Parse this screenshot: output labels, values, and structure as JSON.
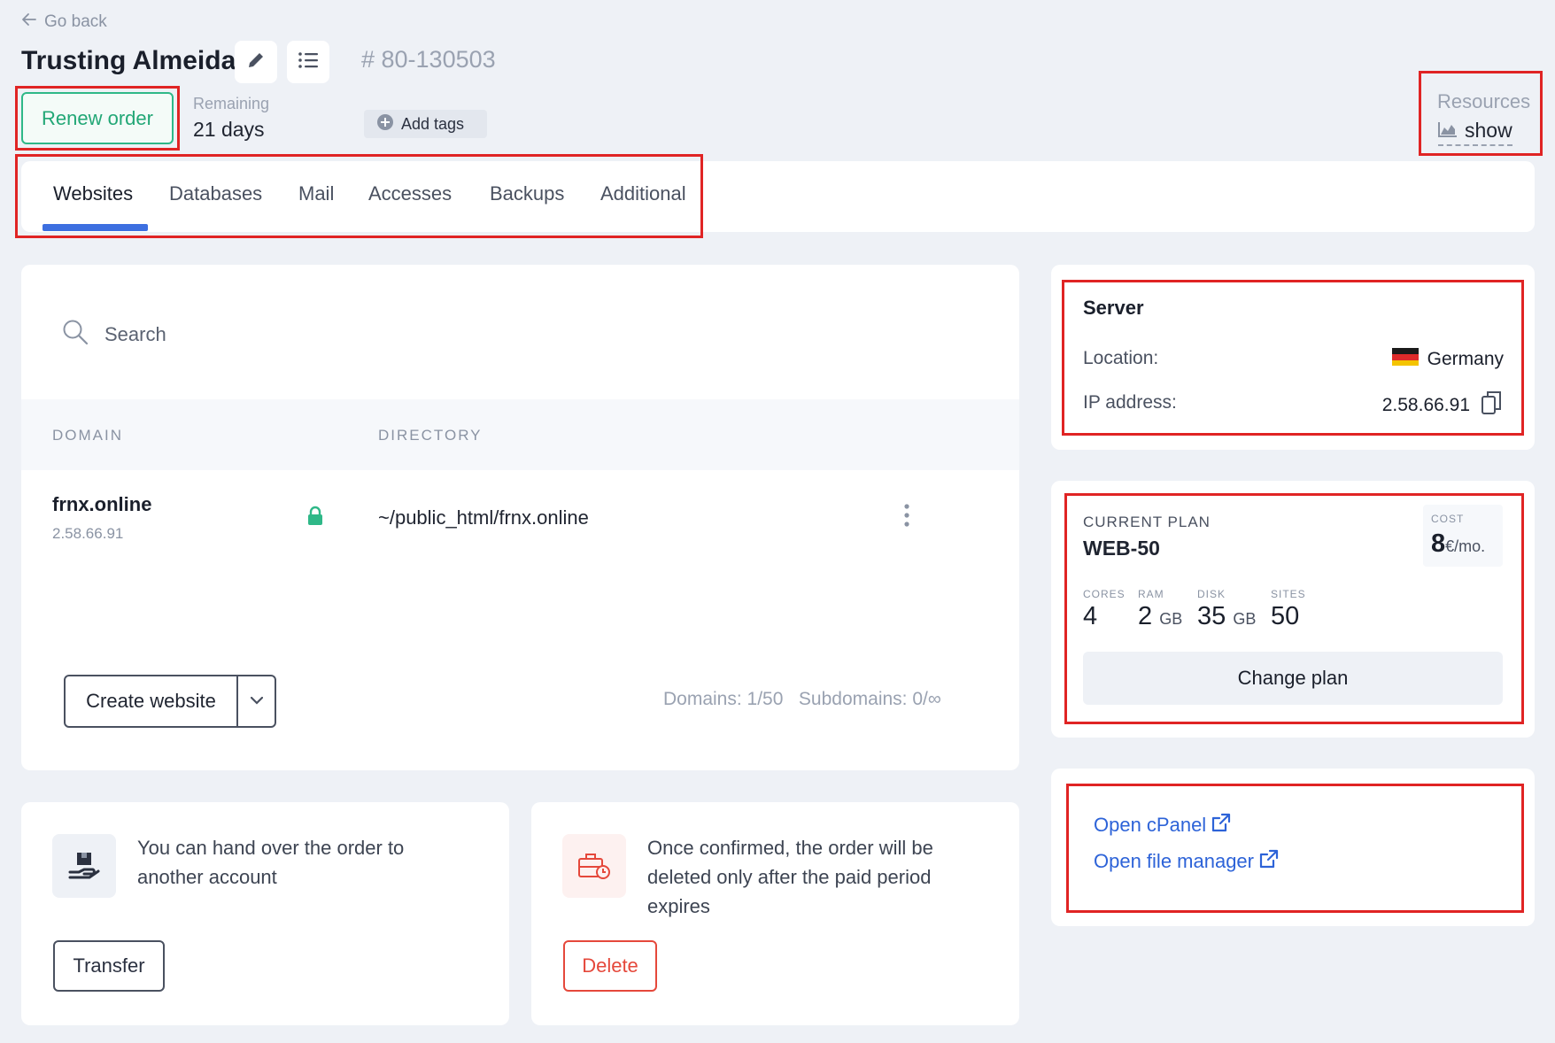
{
  "header": {
    "go_back": "Go back",
    "title": "Trusting Almeida",
    "order_number": "# 80-130503",
    "renew_label": "Renew order",
    "remaining_label": "Remaining",
    "remaining_value": "21 days",
    "add_tags_label": "Add tags",
    "resources_label": "Resources",
    "resources_show": "show"
  },
  "tabs": [
    {
      "label": "Websites",
      "active": true
    },
    {
      "label": "Databases"
    },
    {
      "label": "Mail"
    },
    {
      "label": "Accesses"
    },
    {
      "label": "Backups"
    },
    {
      "label": "Additional"
    }
  ],
  "websites": {
    "search_placeholder": "Search",
    "columns": {
      "domain": "DOMAIN",
      "directory": "DIRECTORY"
    },
    "rows": [
      {
        "domain": "frnx.online",
        "ip": "2.58.66.91",
        "directory": "~/public_html/frnx.online"
      }
    ],
    "create_label": "Create website",
    "domains_stat": "Domains: 1/50",
    "subdomains_stat": "Subdomains: 0/∞"
  },
  "transfer_card": {
    "text": "You can hand over the order to another account",
    "button": "Transfer"
  },
  "delete_card": {
    "text": "Once confirmed, the order will be deleted only after the paid period expires",
    "button": "Delete"
  },
  "server": {
    "title": "Server",
    "location_label": "Location:",
    "location_value": "Germany",
    "ip_label": "IP address:",
    "ip_value": "2.58.66.91"
  },
  "plan": {
    "label": "CURRENT PLAN",
    "name": "WEB-50",
    "cost_label": "COST",
    "cost_value": "8",
    "cost_unit": "€/mo.",
    "specs": [
      {
        "label": "CORES",
        "value": "4",
        "unit": ""
      },
      {
        "label": "RAM",
        "value": "2",
        "unit": "GB"
      },
      {
        "label": "DISK",
        "value": "35",
        "unit": "GB"
      },
      {
        "label": "SITES",
        "value": "50",
        "unit": ""
      }
    ],
    "change_label": "Change plan"
  },
  "links": {
    "cpanel": "Open cPanel",
    "file_manager": "Open file manager"
  },
  "colors": {
    "accent_blue": "#3d6fe0",
    "renew_green": "#22a776",
    "delete_red": "#e5483b",
    "highlight_red": "#e02424"
  },
  "icons": {
    "go_back": "arrow-left-icon",
    "edit": "pencil-icon",
    "list": "list-icon",
    "add_tags": "plus-circle-icon",
    "resources": "chart-area-icon",
    "search": "search-icon",
    "ssl": "lock-icon",
    "row_menu": "kebab-menu-icon",
    "dropdown": "chevron-down-icon",
    "transfer": "hand-box-icon",
    "delete": "briefcase-clock-icon",
    "flag": "germany-flag-icon",
    "copy": "copy-icon",
    "external": "external-link-icon"
  }
}
